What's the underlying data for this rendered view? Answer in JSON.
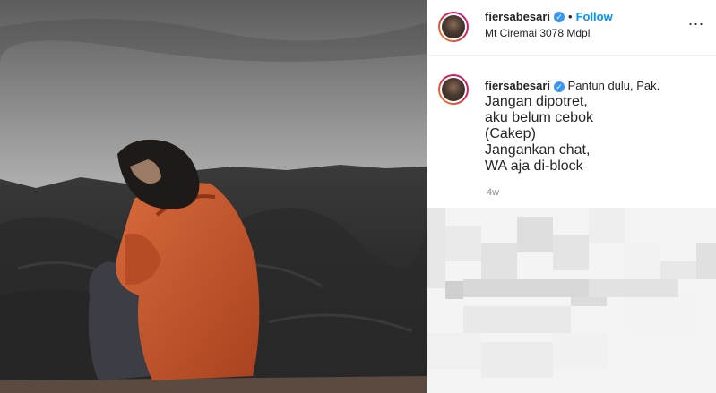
{
  "post": {
    "username": "fiersabesari",
    "verified": true,
    "separator": "•",
    "follow_label": "Follow",
    "location": "Mt Ciremai 3078 Mdpl",
    "more_label": "...",
    "caption_lines": [
      "Pantun dulu, Pak.",
      "Jangan dipotret,",
      "aku belum cebok",
      "(Cakep)",
      "Jangankan chat,",
      "WA aja di-block"
    ],
    "time_ago": "4w"
  },
  "colors": {
    "follow": "#0095f6",
    "verified_badge": "#3897f0",
    "jacket": "#c4552c"
  },
  "icons": {
    "verified": "verified-badge-icon",
    "more": "more-options-icon"
  }
}
